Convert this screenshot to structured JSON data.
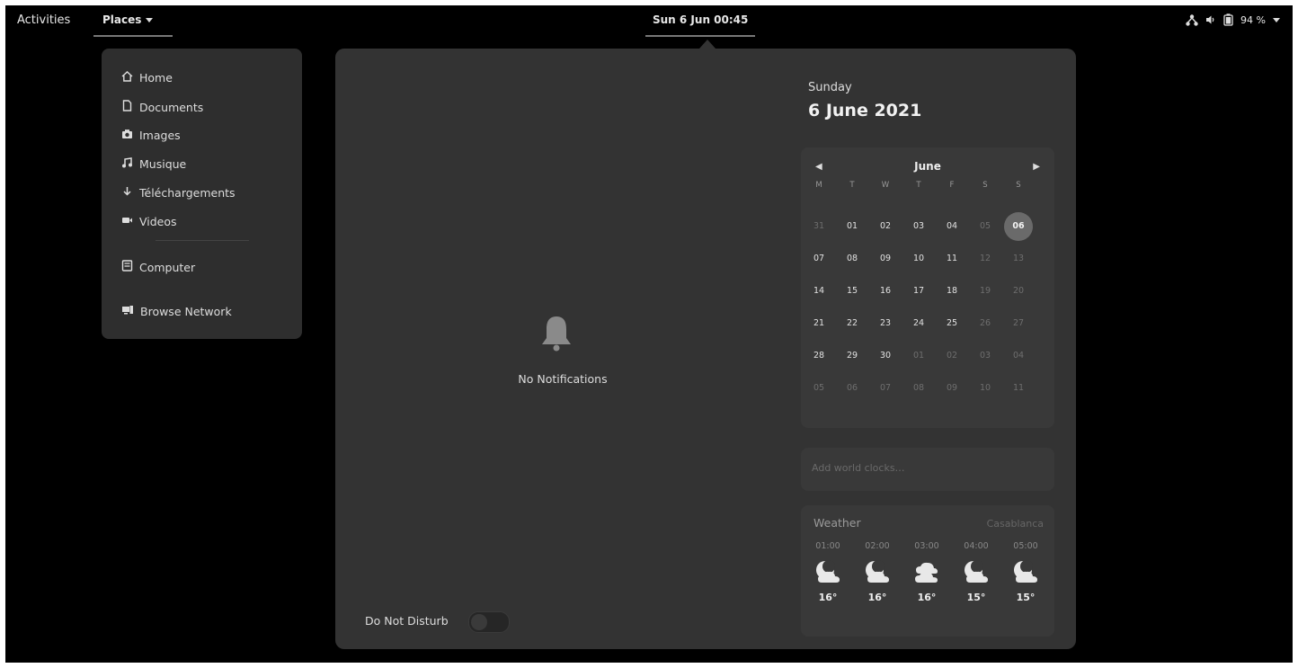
{
  "topbar": {
    "activities": "Activities",
    "places": "Places",
    "clock": "Sun 6 Jun  00:45",
    "battery": "94 %",
    "icons": [
      "network-icon",
      "volume-icon",
      "battery-icon",
      "system-menu-caret-icon"
    ]
  },
  "places_menu": {
    "items": [
      {
        "label": "Home",
        "icon": "home-icon"
      },
      {
        "label": "Documents",
        "icon": "document-icon"
      },
      {
        "label": "Images",
        "icon": "camera-icon"
      },
      {
        "label": "Musique",
        "icon": "music-icon"
      },
      {
        "label": "Téléchargements",
        "icon": "download-icon"
      },
      {
        "label": "Videos",
        "icon": "video-icon"
      },
      {
        "label": "Computer",
        "icon": "computer-icon"
      },
      {
        "label": "Browse Network",
        "icon": "network-browse-icon"
      }
    ]
  },
  "notifications": {
    "empty_label": "No Notifications",
    "dnd_label": "Do Not Disturb",
    "dnd_on": false
  },
  "date_header": {
    "day": "Sunday",
    "date": "6 June 2021"
  },
  "calendar": {
    "month": "June",
    "weekdays": [
      "M",
      "T",
      "W",
      "T",
      "F",
      "S",
      "S"
    ],
    "weeks": [
      [
        {
          "d": "31",
          "o": true
        },
        {
          "d": "01"
        },
        {
          "d": "02"
        },
        {
          "d": "03"
        },
        {
          "d": "04"
        },
        {
          "d": "05",
          "o": true
        },
        {
          "d": "06",
          "t": true
        }
      ],
      [
        {
          "d": "07"
        },
        {
          "d": "08"
        },
        {
          "d": "09"
        },
        {
          "d": "10"
        },
        {
          "d": "11"
        },
        {
          "d": "12",
          "o": true
        },
        {
          "d": "13",
          "o": true
        }
      ],
      [
        {
          "d": "14"
        },
        {
          "d": "15"
        },
        {
          "d": "16"
        },
        {
          "d": "17"
        },
        {
          "d": "18"
        },
        {
          "d": "19",
          "o": true
        },
        {
          "d": "20",
          "o": true
        }
      ],
      [
        {
          "d": "21"
        },
        {
          "d": "22"
        },
        {
          "d": "23"
        },
        {
          "d": "24"
        },
        {
          "d": "25"
        },
        {
          "d": "26",
          "o": true
        },
        {
          "d": "27",
          "o": true
        }
      ],
      [
        {
          "d": "28"
        },
        {
          "d": "29"
        },
        {
          "d": "30"
        },
        {
          "d": "01",
          "o": true
        },
        {
          "d": "02",
          "o": true
        },
        {
          "d": "03",
          "o": true
        },
        {
          "d": "04",
          "o": true
        }
      ],
      [
        {
          "d": "05",
          "o": true
        },
        {
          "d": "06",
          "o": true
        },
        {
          "d": "07",
          "o": true
        },
        {
          "d": "08",
          "o": true
        },
        {
          "d": "09",
          "o": true
        },
        {
          "d": "10",
          "o": true
        },
        {
          "d": "11",
          "o": true
        }
      ]
    ]
  },
  "events": {
    "label": "Add world clocks…"
  },
  "weather": {
    "title": "Weather",
    "location": "Casablanca",
    "forecast": [
      {
        "time": "01:00",
        "icon": "night-cloudy-icon",
        "temp": "16°"
      },
      {
        "time": "02:00",
        "icon": "night-cloudy-icon",
        "temp": "16°"
      },
      {
        "time": "03:00",
        "icon": "cloudy-icon",
        "temp": "16°"
      },
      {
        "time": "04:00",
        "icon": "night-cloudy-icon",
        "temp": "15°"
      },
      {
        "time": "05:00",
        "icon": "night-cloudy-icon",
        "temp": "15°"
      }
    ]
  }
}
